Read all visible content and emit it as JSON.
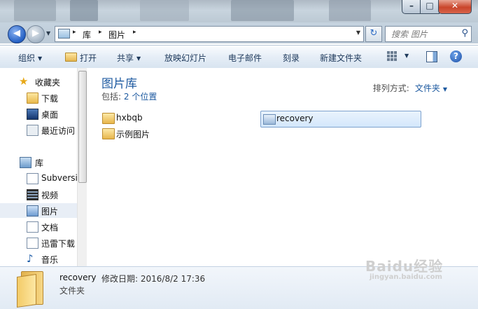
{
  "window": {
    "controls": {
      "minimize": "–",
      "maximize": "□",
      "close": "✕"
    }
  },
  "nav": {
    "back_glyph": "◀",
    "forward_glyph": "▶",
    "history_glyph": "▼"
  },
  "address": {
    "sep": "▸",
    "crumbs": [
      "库",
      "图片"
    ],
    "dropdown_glyph": "▼",
    "refresh_glyph": "↻"
  },
  "search": {
    "placeholder": "搜索 图片",
    "icon_glyph": "⚲"
  },
  "toolbar": {
    "organize": "组织",
    "open": "打开",
    "share": "共享",
    "slideshow": "放映幻灯片",
    "email": "电子邮件",
    "burn": "刻录",
    "new_folder": "新建文件夹",
    "dropdown_glyph": "▼",
    "help_glyph": "?"
  },
  "sidebar": {
    "favorites": {
      "label": "收藏夹",
      "icon": "star-icon"
    },
    "favorite_items": [
      {
        "label": "下载",
        "icon": "downloads-folder-icon"
      },
      {
        "label": "桌面",
        "icon": "desktop-icon"
      },
      {
        "label": "最近访问",
        "icon": "recent-places-icon"
      }
    ],
    "libraries": {
      "label": "库",
      "icon": "library-icon"
    },
    "library_items": [
      {
        "label": "Subversi",
        "icon": "subversion-library-icon"
      },
      {
        "label": "视频",
        "icon": "videos-library-icon"
      },
      {
        "label": "图片",
        "icon": "pictures-library-icon",
        "selected": true
      },
      {
        "label": "文档",
        "icon": "documents-library-icon"
      },
      {
        "label": "迅雷下载",
        "icon": "thunder-downloads-icon"
      },
      {
        "label": "音乐",
        "icon": "music-library-icon"
      }
    ],
    "star_glyph": "★",
    "note_glyph": "♪"
  },
  "library": {
    "title": "图片库",
    "includes_label": "包括:",
    "includes_value": "2 个位置",
    "arrange_label": "排列方式:",
    "arrange_value": "文件夹"
  },
  "files": [
    {
      "name": "hxbqb",
      "icon": "folder-icon"
    },
    {
      "name": "示例图片",
      "icon": "folder-icon"
    },
    {
      "name": "recovery",
      "icon": "image-folder-icon",
      "selected": true
    }
  ],
  "details": {
    "name": "recovery",
    "modified_label": "修改日期:",
    "modified_value": "2016/8/2 17:36",
    "type": "文件夹"
  },
  "watermark": {
    "main": "Baidu经验",
    "sub": "jingyan.baidu.com"
  },
  "colors": {
    "accent": "#1e5aa0",
    "toolbar_text": "#1e395b",
    "selection_fill": "#d3e7fb",
    "selection_border": "#7da2ce",
    "close_button": "#c9452b"
  }
}
